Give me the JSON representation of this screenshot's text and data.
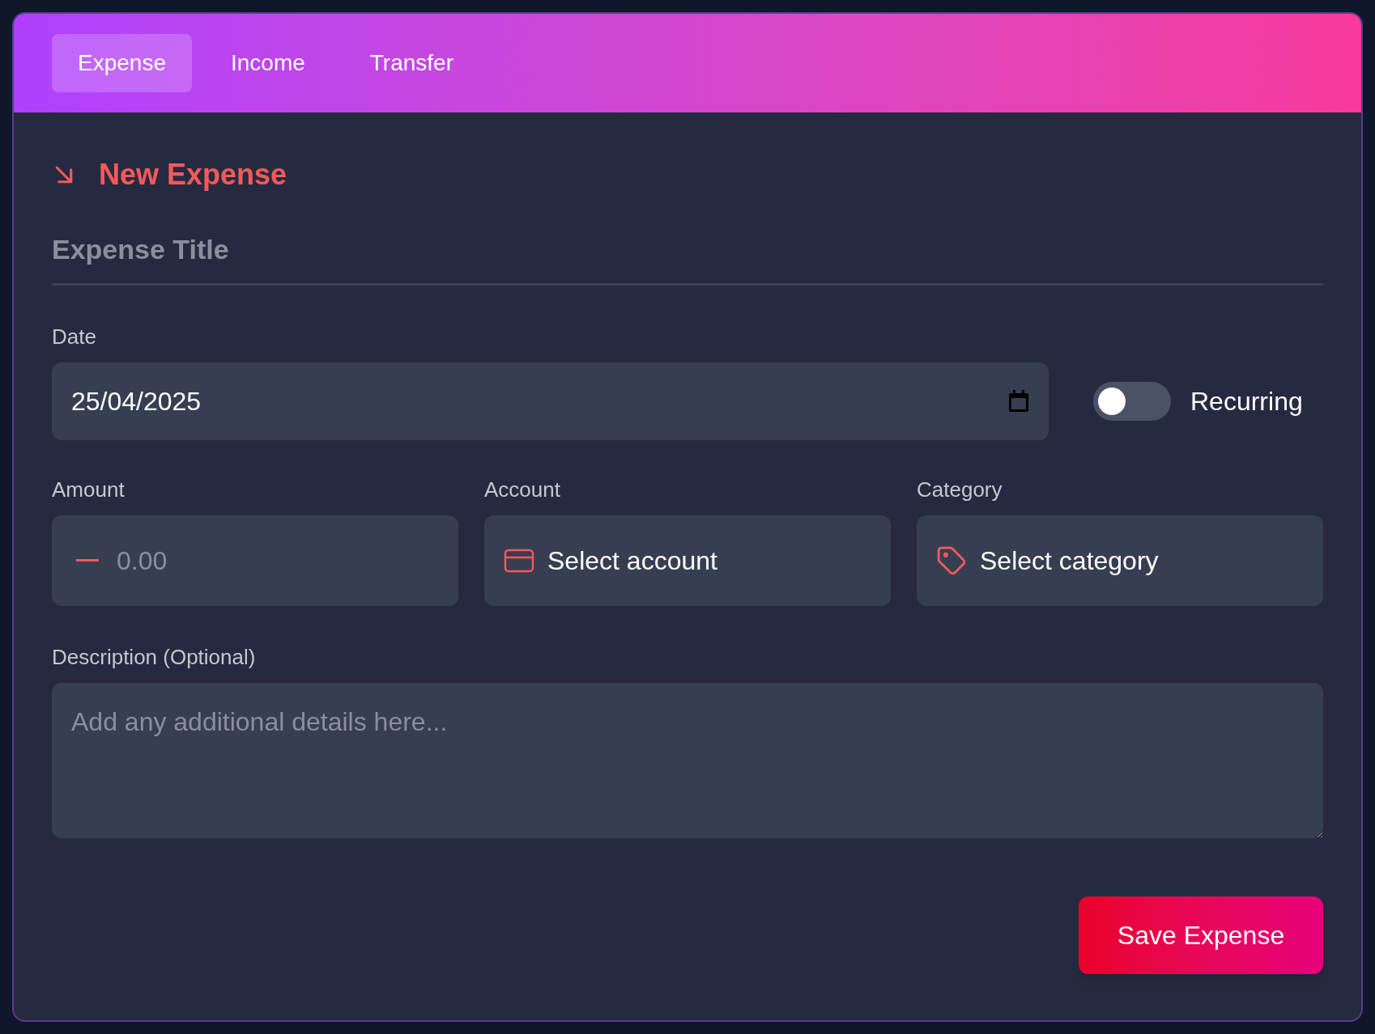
{
  "tabs": [
    {
      "label": "Expense",
      "selected": true
    },
    {
      "label": "Income",
      "selected": false
    },
    {
      "label": "Transfer",
      "selected": false
    }
  ],
  "heading": "New Expense",
  "title_field": {
    "placeholder": "Expense Title"
  },
  "date": {
    "label": "Date",
    "value": "25/04/2025"
  },
  "recurring": {
    "label": "Recurring",
    "on": false
  },
  "amount": {
    "label": "Amount",
    "placeholder": "0.00"
  },
  "account": {
    "label": "Account",
    "value": "Select account"
  },
  "category": {
    "label": "Category",
    "value": "Select category"
  },
  "description": {
    "label": "Description (Optional)",
    "placeholder": "Add any additional details here..."
  },
  "save_button": "Save Expense"
}
